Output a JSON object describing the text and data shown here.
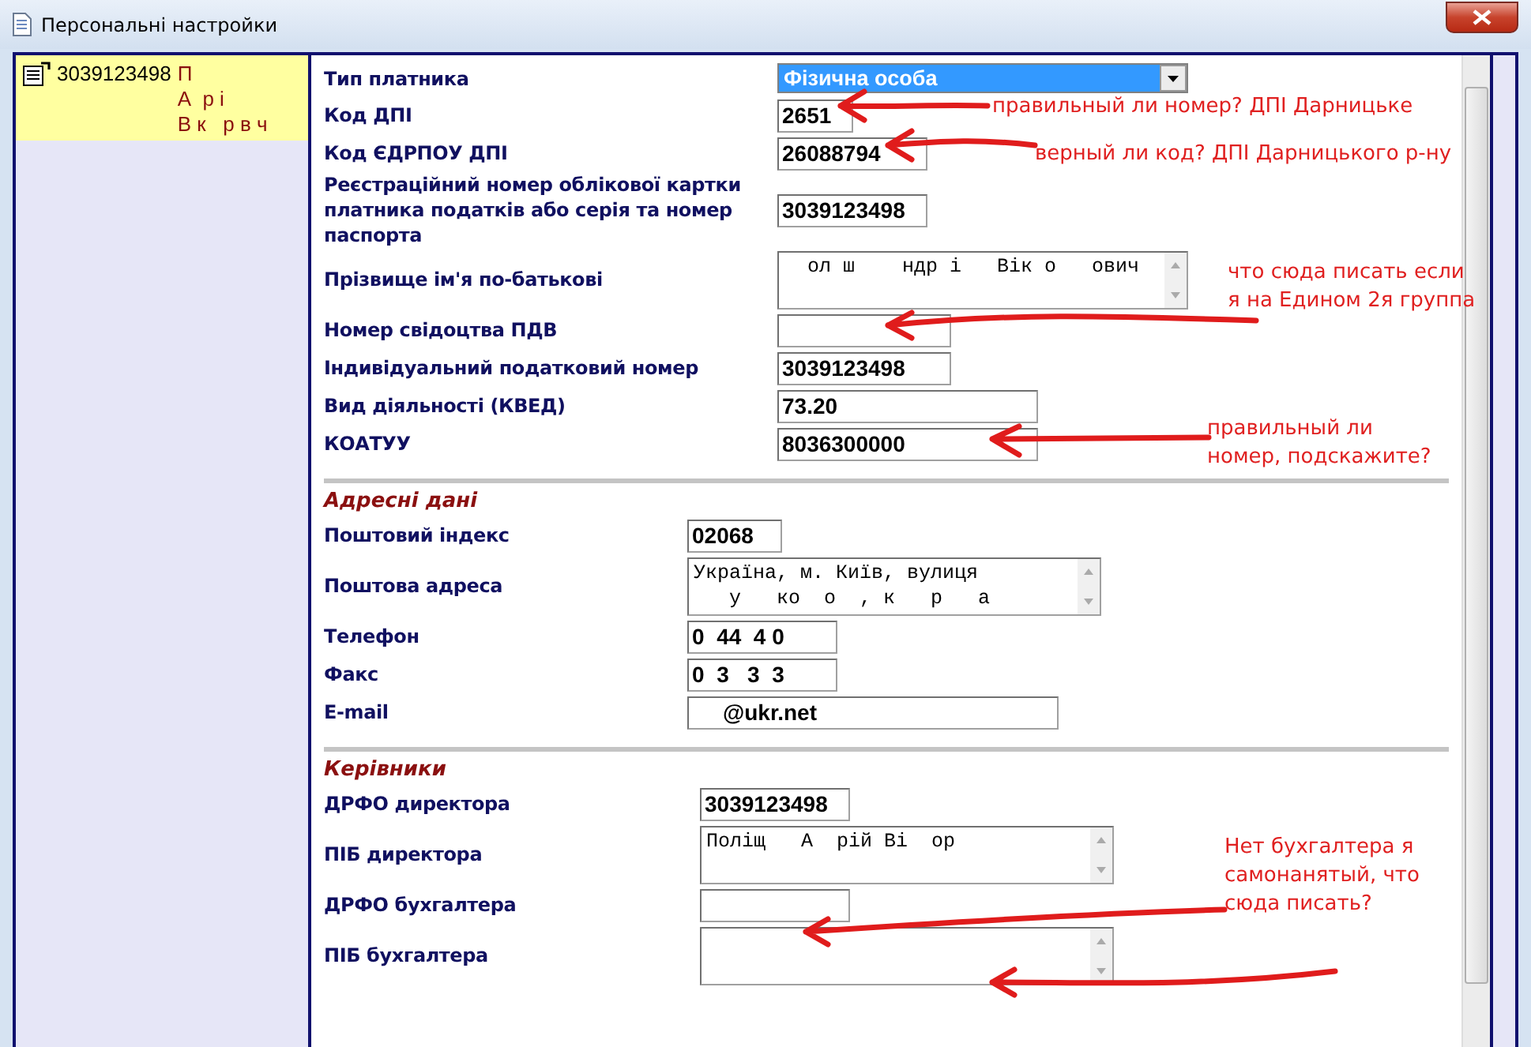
{
  "window": {
    "title": "Персональні настройки"
  },
  "sidebar": {
    "items": [
      {
        "code": "3039123498",
        "name_lines": [
          "П",
          "А  р і",
          "В к   р в ч"
        ],
        "selected": true
      }
    ]
  },
  "sections": [
    {
      "fields": [
        {
          "label": "Тип платника",
          "kind": "select",
          "value": "Фізична особа"
        },
        {
          "label": "Код ДПІ",
          "kind": "input",
          "value": "2651"
        },
        {
          "label": "Код ЄДРПОУ ДПІ",
          "kind": "input",
          "value": "26088794"
        },
        {
          "label": "Реєстраційний номер облікової картки платника податків або серія та номер паспорта",
          "kind": "input",
          "value": "3039123498"
        },
        {
          "label": "Прізвище ім'я по-батькові",
          "kind": "textarea",
          "value": "  ол ш    ндр і   Вік о   ович"
        },
        {
          "label": "Номер свідоцтва ПДВ",
          "kind": "input"
        },
        {
          "label": "Індивідуальний податковий номер",
          "kind": "input",
          "value": "3039123498"
        },
        {
          "label": "Вид діяльності (КВЕД)",
          "kind": "input",
          "value": "73.20"
        },
        {
          "label": "КОАТУУ",
          "kind": "input",
          "value": "8036300000"
        }
      ]
    },
    {
      "heading": "Адресні дані",
      "fields": [
        {
          "label": "Поштовий індекс",
          "kind": "input",
          "value": "02068"
        },
        {
          "label": "Поштова адреса",
          "kind": "textarea",
          "value": "Україна, м. Київ, вулиця\n   у   ко  о  , к   р   а  "
        },
        {
          "label": "Телефон",
          "kind": "input",
          "value": "0  44  4 0"
        },
        {
          "label": "Факс",
          "kind": "input",
          "value": "0  3   3  3"
        },
        {
          "label": "E-mail",
          "kind": "input",
          "value": "     @ukr.net"
        }
      ]
    },
    {
      "heading": "Керівники",
      "fields": [
        {
          "label": "ДРФО директора",
          "kind": "input",
          "value": "3039123498"
        },
        {
          "label": "ПІБ директора",
          "kind": "textarea",
          "value": "Поліщ   А  рій Ві  ор  "
        },
        {
          "label": "ДРФО бухгалтера",
          "kind": "input"
        },
        {
          "label": "ПІБ бухгалтера",
          "kind": "textarea"
        }
      ]
    }
  ],
  "annotations": [
    {
      "text": "правильный ли номер? ДПІ Дарницьке"
    },
    {
      "text": "верный ли код? ДПІ Дарницького р-ну"
    },
    {
      "text": "что сюда писать если\nя на Едином 2я группа"
    },
    {
      "text": "правильный ли\nномер, подскажите?"
    },
    {
      "text": "Нет бухгалтера я\nсамонанятый, что\nсюда писать?"
    }
  ]
}
